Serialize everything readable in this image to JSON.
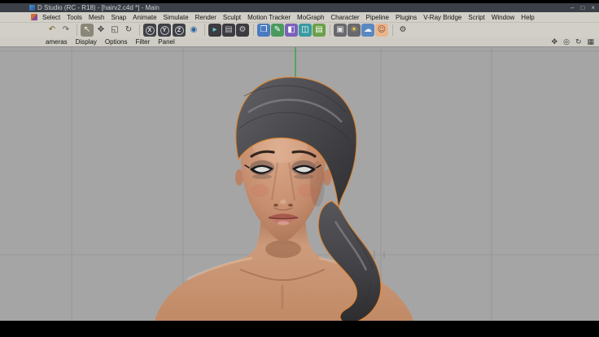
{
  "titlebar": {
    "title": "D Studio (RC - R18) - [hairv2.c4d *] - Main",
    "minimize": "–",
    "maximize": "□",
    "close": "×"
  },
  "menubar": {
    "items": [
      "Select",
      "Tools",
      "Mesh",
      "Snap",
      "Animate",
      "Simulate",
      "Render",
      "Sculpt",
      "Motion Tracker",
      "MoGraph",
      "Character",
      "Pipeline",
      "Plugins",
      "V-Ray Bridge",
      "Script",
      "Window",
      "Help"
    ]
  },
  "toolbar": {
    "axis_buttons": [
      "X",
      "Y",
      "Z"
    ],
    "icons": [
      {
        "name": "undo-icon",
        "glyph": "↶",
        "fg": "#6e5e22",
        "bg": "transparent"
      },
      {
        "name": "redo-icon",
        "glyph": "↷",
        "fg": "#5a564c",
        "bg": "transparent"
      },
      {
        "name": "live-selection-icon",
        "glyph": "↖",
        "fg": "#f8f5ec",
        "bg": "#8a8678"
      },
      {
        "name": "move-tool-icon",
        "glyph": "✥",
        "fg": "#3f3f3f",
        "bg": "transparent"
      },
      {
        "name": "scale-tool-icon",
        "glyph": "◱",
        "fg": "#3f3f3f",
        "bg": "transparent"
      },
      {
        "name": "rotate-tool-icon",
        "glyph": "↻",
        "fg": "#3f3f3f",
        "bg": "transparent"
      },
      {
        "name": "coordinate-system-icon",
        "glyph": "◉",
        "fg": "#2f66a0",
        "bg": "transparent"
      },
      {
        "name": "render-view-icon",
        "glyph": "▸",
        "fg": "#64c8cc",
        "bg": "#3b3b40"
      },
      {
        "name": "render-picture-viewer-icon",
        "glyph": "▤",
        "fg": "#c0c0c4",
        "bg": "#3b3b40"
      },
      {
        "name": "render-settings-icon",
        "glyph": "⚙",
        "fg": "#c8c8cc",
        "bg": "#3b3b40"
      },
      {
        "name": "add-cube-icon",
        "glyph": "❒",
        "fg": "#ffffff",
        "bg": "#4a7ac0"
      },
      {
        "name": "add-spline-icon",
        "glyph": "✎",
        "fg": "#ffffff",
        "bg": "#4a9a5e"
      },
      {
        "name": "subdivision-surface-icon",
        "glyph": "◧",
        "fg": "#ffffff",
        "bg": "#7a62b8"
      },
      {
        "name": "array-object-icon",
        "glyph": "◫",
        "fg": "#ffffff",
        "bg": "#3a9aa0"
      },
      {
        "name": "floor-object-icon",
        "glyph": "▤",
        "fg": "#ffffff",
        "bg": "#6aa04a"
      },
      {
        "name": "camera-object-icon",
        "glyph": "▣",
        "fg": "#e0e0e0",
        "bg": "#68686e"
      },
      {
        "name": "light-object-icon",
        "glyph": "☀",
        "fg": "#ffd84a",
        "bg": "#68686e"
      },
      {
        "name": "sky-object-icon",
        "glyph": "☁",
        "fg": "#eaf4ff",
        "bg": "#5a88c0"
      },
      {
        "name": "character-face-icon",
        "glyph": "☺",
        "fg": "#7a4a30",
        "bg": "#eab48c"
      },
      {
        "name": "gear-icon",
        "glyph": "⚙",
        "fg": "#3a3a3a",
        "bg": "transparent"
      }
    ]
  },
  "viewport_bar": {
    "items": [
      "ameras",
      "Display",
      "Options",
      "Filter",
      "Panel"
    ],
    "nav_icons": [
      {
        "name": "pan-view-icon",
        "glyph": "✥"
      },
      {
        "name": "zoom-view-icon",
        "glyph": "◎"
      },
      {
        "name": "rotate-view-icon",
        "glyph": "↻"
      },
      {
        "name": "layout-toggle-icon",
        "glyph": "▦"
      }
    ]
  },
  "viewport": {
    "background": "#a5a5a5",
    "grid_color": "#969696",
    "axis_color": "#44a044",
    "selection_outline": "#e8882f",
    "hair_color": "#47474b",
    "skin_color": "#c68e6f"
  }
}
